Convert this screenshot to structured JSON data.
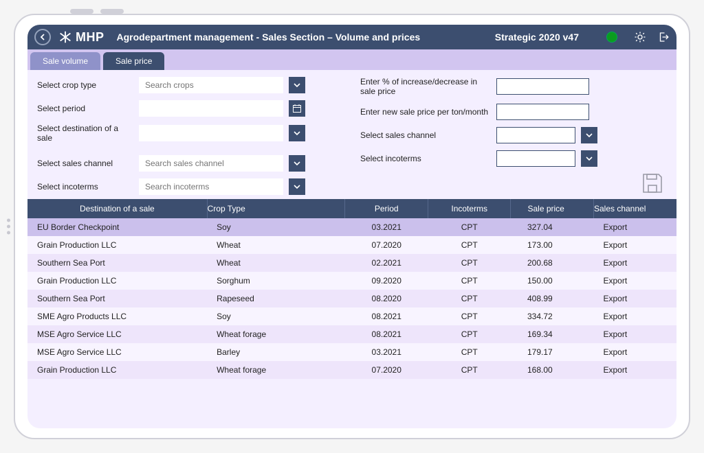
{
  "header": {
    "brand": "MHP",
    "title": "Agrodepartment management - Sales Section – Volume and prices",
    "version": "Strategic 2020 v47"
  },
  "tabs": {
    "inactive": "Sale volume",
    "active": "Sale price"
  },
  "filters_left": {
    "crop_type_label": "Select crop type",
    "crop_type_placeholder": "Search crops",
    "period_label": "Select period",
    "dest_label": "Select destination of a sale",
    "channel_label": "Select sales channel",
    "channel_placeholder": "Search sales channel",
    "incoterms_label": "Select incoterms",
    "incoterms_placeholder": "Search incoterms"
  },
  "filters_right": {
    "pct_label": "Enter % of increase/decrease in sale price",
    "newprice_label": "Enter new sale price per ton/month",
    "channel_label": "Select sales channel",
    "incoterms_label": "Select incoterms"
  },
  "table": {
    "headers": {
      "dest": "Destination of a sale",
      "crop": "Crop Type",
      "period": "Period",
      "inco": "Incoterms",
      "price": "Sale price",
      "chan": "Sales channel"
    },
    "rows": [
      {
        "dest": "EU Border Checkpoint",
        "crop": "Soy",
        "period": "03.2021",
        "inco": "CPT",
        "price": "327.04",
        "chan": "Export"
      },
      {
        "dest": "Grain Production LLC",
        "crop": "Wheat",
        "period": "07.2020",
        "inco": "CPT",
        "price": "173.00",
        "chan": "Export"
      },
      {
        "dest": "Southern Sea Port",
        "crop": "Wheat",
        "period": "02.2021",
        "inco": "CPT",
        "price": "200.68",
        "chan": "Export"
      },
      {
        "dest": "Grain Production LLC",
        "crop": "Sorghum",
        "period": "09.2020",
        "inco": "CPT",
        "price": "150.00",
        "chan": "Export"
      },
      {
        "dest": "Southern Sea Port",
        "crop": "Rapeseed",
        "period": "08.2020",
        "inco": "CPT",
        "price": "408.99",
        "chan": "Export"
      },
      {
        "dest": "SME Agro Products LLC",
        "crop": "Soy",
        "period": "08.2021",
        "inco": "CPT",
        "price": "334.72",
        "chan": "Export"
      },
      {
        "dest": "MSE Agro Service LLC",
        "crop": "Wheat forage",
        "period": "08.2021",
        "inco": "CPT",
        "price": "169.34",
        "chan": "Export"
      },
      {
        "dest": "MSE Agro Service LLC",
        "crop": "Barley",
        "period": "03.2021",
        "inco": "CPT",
        "price": "179.17",
        "chan": "Export"
      },
      {
        "dest": "Grain Production LLC",
        "crop": "Wheat forage",
        "period": "07.2020",
        "inco": "CPT",
        "price": "168.00",
        "chan": "Export"
      }
    ]
  }
}
